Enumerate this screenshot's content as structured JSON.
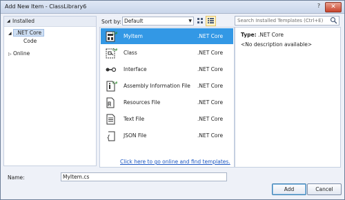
{
  "window": {
    "title": "Add New Item - ClassLibrary6",
    "help": "?",
    "close": "✕"
  },
  "left_panel": {
    "header": "Installed",
    "tree": [
      {
        "label": ".NET Core",
        "expanded": true,
        "selected": true
      },
      {
        "label": "Code"
      },
      {
        "label": "Online",
        "expanded": false
      }
    ]
  },
  "toolbar": {
    "sort_label": "Sort by:",
    "sort_value": "Default"
  },
  "search": {
    "placeholder": "Search Installed Templates (Ctrl+E)"
  },
  "templates": [
    {
      "name": "MyItem",
      "tag": ".NET Core",
      "icon": "myitem-icon",
      "selected": true
    },
    {
      "name": "Class",
      "tag": ".NET Core",
      "icon": "class-icon"
    },
    {
      "name": "Interface",
      "tag": ".NET Core",
      "icon": "interface-icon"
    },
    {
      "name": "Assembly Information File",
      "tag": ".NET Core",
      "icon": "assembly-info-icon"
    },
    {
      "name": "Resources File",
      "tag": ".NET Core",
      "icon": "resources-file-icon"
    },
    {
      "name": "Text File",
      "tag": ".NET Core",
      "icon": "text-file-icon"
    },
    {
      "name": "JSON File",
      "tag": ".NET Core",
      "icon": "json-file-icon"
    }
  ],
  "online_link": "Click here to go online and find templates.",
  "details": {
    "type_label": "Type:",
    "type_value": ".NET Core",
    "description": "<No description available>"
  },
  "footer": {
    "name_label": "Name:",
    "name_value": "MyItem.cs",
    "add": "Add",
    "cancel": "Cancel"
  },
  "colors": {
    "selection": "#3398e5",
    "link": "#1a55c2",
    "panel_bg": "#eef1f8"
  }
}
